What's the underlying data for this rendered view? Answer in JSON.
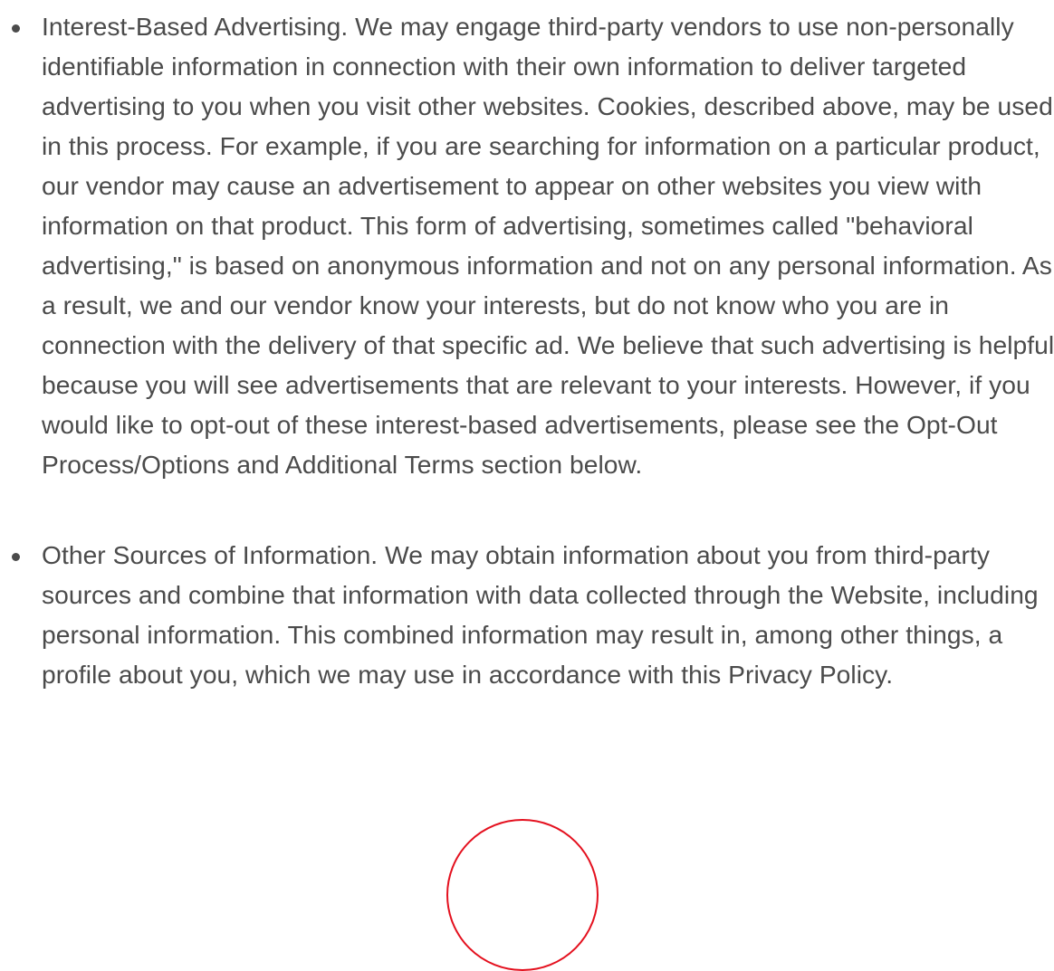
{
  "policy": {
    "items": [
      {
        "text": "Interest-Based Advertising. We may engage third-party vendors to use non-personally identifiable information in connection with their own information to deliver targeted advertising to you when you visit other websites. Cookies, described above, may be used in this process. For example, if you are searching for information on a particular product, our vendor may cause an advertisement to appear on other websites you view with information on that product. This form of advertising, sometimes called \"behavioral advertising,\" is based on anonymous information and not on any personal information. As a result, we and our vendor know your interests, but do not know who you are in connection with the delivery of that specific ad. We believe that such advertising is helpful because you will see advertisements that are relevant to your interests. However, if you would like to opt-out of these interest-based advertisements, please see the Opt-Out Process/Options and Additional Terms section below."
      },
      {
        "text": "Other Sources of Information. We may obtain information about you from third-party sources and combine that information with data collected through the Website, including personal information. This combined information may result in, among other things, a profile about you, which we may use in accordance with this Privacy Policy."
      }
    ]
  },
  "overlay": {
    "border_color": "#e4101e"
  },
  "colors": {
    "text": "#4b4b4b",
    "background": "#ffffff"
  }
}
